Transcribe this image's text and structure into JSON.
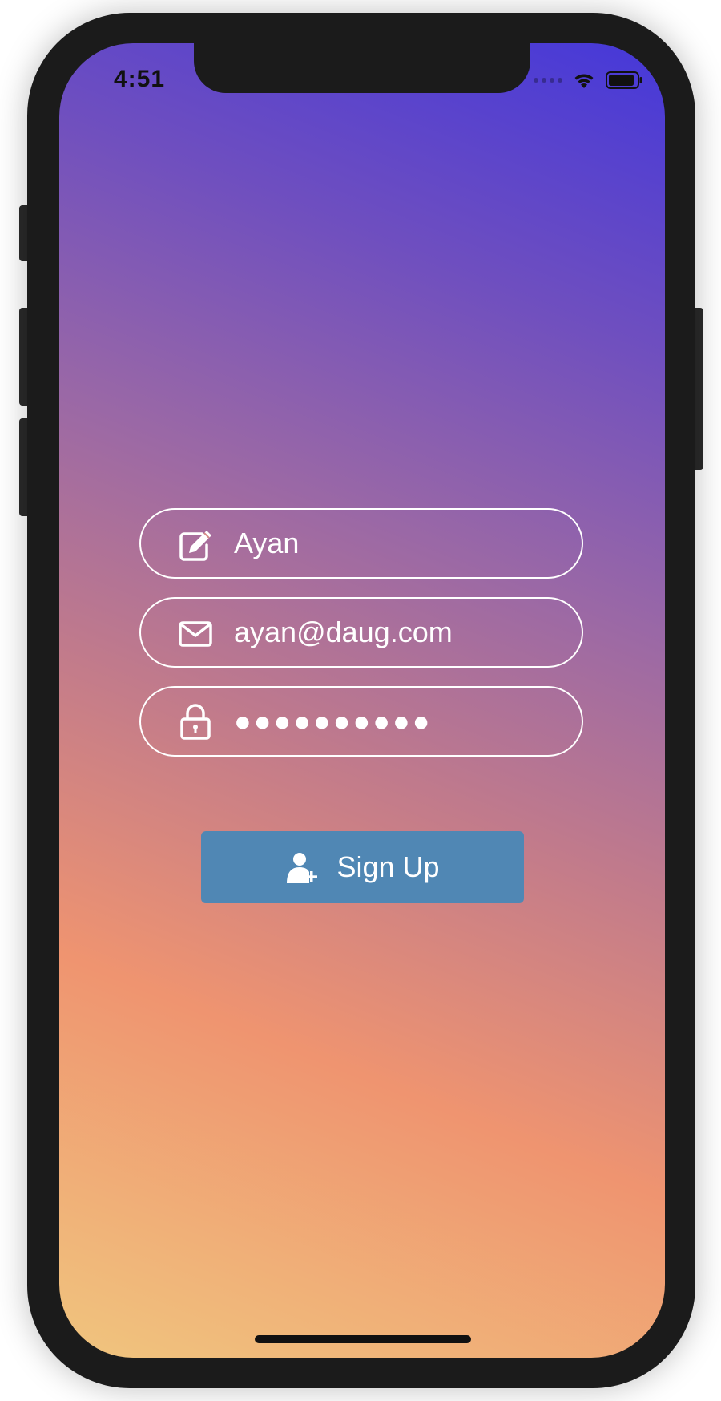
{
  "status_bar": {
    "time": "4:51"
  },
  "form": {
    "name_value": "Ayan",
    "email_value": "ayan@daug.com",
    "password_masked": "●●●●●●●●●●"
  },
  "signup_button": {
    "label": "Sign Up"
  },
  "colors": {
    "button_bg": "#5087b4",
    "gradient_top_right": "#4538d9",
    "gradient_mid": "#ef9470",
    "gradient_bottom_left": "#f0c57e"
  },
  "icons": {
    "name_field": "edit-icon",
    "email_field": "envelope-icon",
    "password_field": "lock-icon",
    "signup": "add-user-icon",
    "status": [
      "signal-dots-icon",
      "wifi-icon",
      "battery-icon"
    ]
  }
}
